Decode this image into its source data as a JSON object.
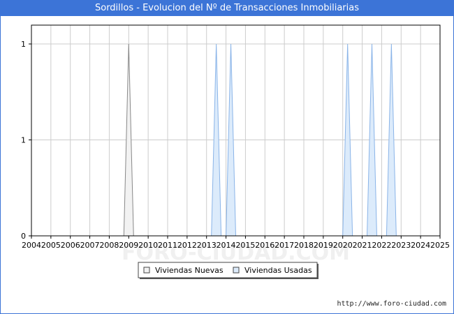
{
  "window": {
    "title": "Sordillos - Evolucion del Nº de Transacciones Inmobiliarias",
    "footer_url": "http://www.foro-ciudad.com",
    "watermark": "FORO-CIUDAD.COM"
  },
  "chart_data": {
    "type": "area",
    "title": "Sordillos - Evolucion del Nº de Transacciones Inmobiliarias",
    "x_ticks": [
      "2004",
      "2005",
      "2006",
      "2007",
      "2008",
      "2009",
      "2010",
      "2011",
      "2012",
      "2013",
      "2014",
      "2015",
      "2016",
      "2017",
      "2018",
      "2019",
      "2020",
      "2021",
      "2022",
      "2023",
      "2024",
      "2025"
    ],
    "xlim": [
      2004,
      2025
    ],
    "y_tick_labels": [
      "0",
      "1",
      "1"
    ],
    "ylim": [
      0,
      1
    ],
    "grid": true,
    "legend_position": "bottom",
    "series": [
      {
        "name": "Viviendas Nuevas",
        "color": "#888888",
        "fill": "#f2f2f2",
        "points": [
          [
            2008.75,
            0
          ],
          [
            2009,
            1
          ],
          [
            2009.25,
            0
          ]
        ]
      },
      {
        "name": "Viviendas Usadas",
        "color": "#8ab4e8",
        "fill": "#dcebfb",
        "points": [
          [
            2013.25,
            0
          ],
          [
            2013.5,
            1
          ],
          [
            2013.75,
            0
          ],
          [
            2014,
            0
          ],
          [
            2014.25,
            1
          ],
          [
            2014.5,
            0
          ],
          [
            2020,
            0
          ],
          [
            2020.25,
            1
          ],
          [
            2020.5,
            0
          ],
          [
            2021.25,
            0
          ],
          [
            2021.5,
            1
          ],
          [
            2021.75,
            0
          ],
          [
            2022.25,
            0
          ],
          [
            2022.5,
            1
          ],
          [
            2022.75,
            0
          ]
        ]
      }
    ]
  }
}
